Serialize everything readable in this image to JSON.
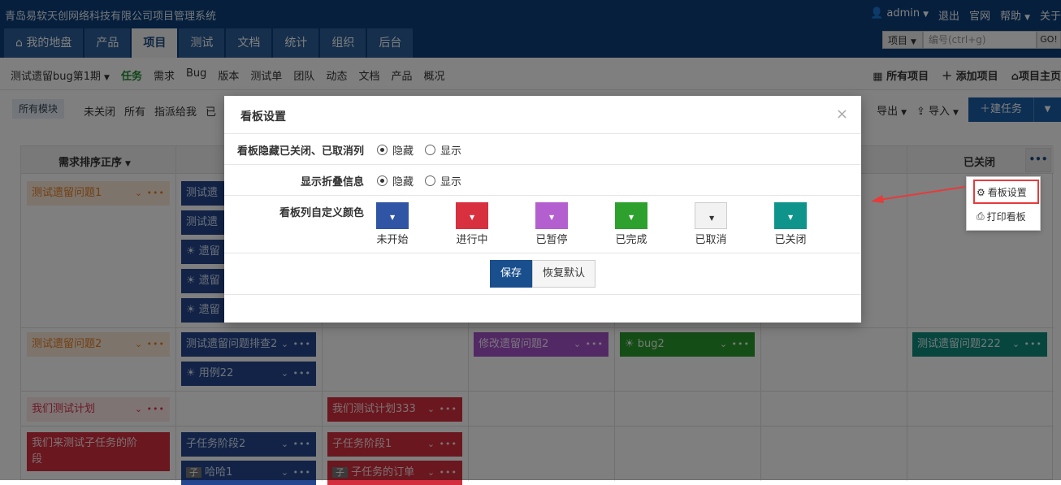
{
  "header": {
    "company": "青岛易软天创网络科技有限公司项目管理系统",
    "user": "admin",
    "links": [
      "退出",
      "官网",
      "帮助",
      "关于"
    ]
  },
  "main_nav": {
    "tabs": [
      "我的地盘",
      "产品",
      "项目",
      "测试",
      "文档",
      "统计",
      "组织",
      "后台"
    ],
    "active": "项目",
    "search_type": "项目",
    "search_placeholder": "编号(ctrl+g)",
    "go": "GO!"
  },
  "sub_nav": {
    "project": "测试遗留bug第1期",
    "items": [
      "任务",
      "需求",
      "Bug",
      "版本",
      "测试单",
      "团队",
      "动态",
      "文档",
      "产品",
      "概况"
    ],
    "right": [
      "所有项目",
      "添加项目",
      "项目主页"
    ]
  },
  "filter_bar": {
    "module": "所有模块",
    "filters": [
      "未关闭",
      "所有",
      "指派给我",
      "已"
    ],
    "export": "导出",
    "import": "导入",
    "new_task": "建任务"
  },
  "board": {
    "sort_label": "需求排序正序",
    "closed_label": "已关闭",
    "more": "•••",
    "cards": {
      "r1c1": "测试遗留问题1",
      "r1c2a": "测试遗",
      "r1c2b": "测试遗",
      "r1c2c": "遗留",
      "r1c2d": "遗留",
      "r1c2e": "遗留",
      "r2c1": "测试遗留问题2",
      "r2c2a": "测试遗留问题排查2",
      "r2c2b": "用例22",
      "r2c4": "修改遗留问题2",
      "r2c5": "bug2",
      "r2c7": "测试遗留问题222",
      "r3c1": "我们测试计划",
      "r3c3": "我们测试计划333",
      "r4c1a": "我们来测试子任务的阶",
      "r4c1b": "段",
      "r4c2a": "子任务阶段2",
      "r4c2b": "哈哈1",
      "r4c3a": "子任务阶段1",
      "r4c3b": "子任务的订单",
      "sub_tag": "子"
    }
  },
  "dropdown": {
    "kanban_settings": "看板设置",
    "print_kanban": "打印看板"
  },
  "modal": {
    "title": "看板设置",
    "close": "×",
    "row1_label": "看板隐藏已关闭、已取消列",
    "row2_label": "显示折叠信息",
    "row3_label": "看板列自定义颜色",
    "hide": "隐藏",
    "show": "显示",
    "colors": [
      {
        "name": "未开始",
        "color": "#2f55a4"
      },
      {
        "name": "进行中",
        "color": "#d9303f"
      },
      {
        "name": "已暂停",
        "color": "#b45fd0"
      },
      {
        "name": "已完成",
        "color": "#2ea02e"
      },
      {
        "name": "已取消",
        "color": "#f2f2f2"
      },
      {
        "name": "已关闭",
        "color": "#0e948a"
      }
    ],
    "save": "保存",
    "reset": "恢复默认"
  }
}
